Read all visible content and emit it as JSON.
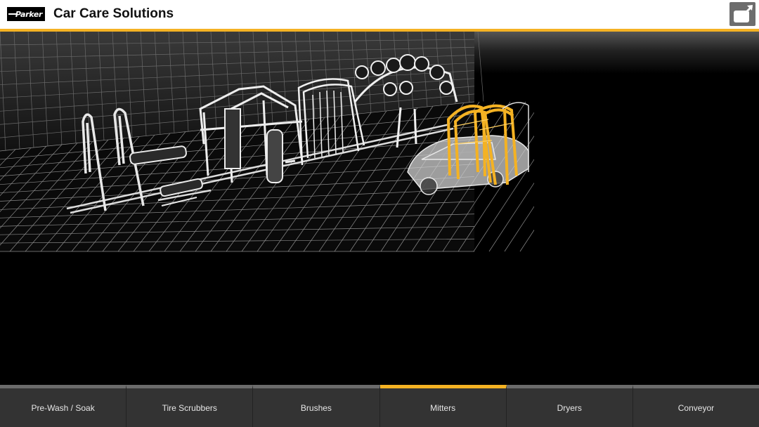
{
  "header": {
    "logo_text": "Parker",
    "title": "Car Care Solutions"
  },
  "icons": {
    "expand": "expand-icon"
  },
  "colors": {
    "accent": "#f4b223",
    "header_bg": "#ffffff",
    "tab_bg": "#333333",
    "tab_border": "#6b6b6b",
    "wireframe": "#e0e0e0",
    "highlight": "#f4b223"
  },
  "tabs": [
    {
      "label": "Pre-Wash / Soak",
      "active": false
    },
    {
      "label": "Tire Scrubbers",
      "active": false
    },
    {
      "label": "Brushes",
      "active": false
    },
    {
      "label": "Mitters",
      "active": true
    },
    {
      "label": "Dryers",
      "active": false
    },
    {
      "label": "Conveyor",
      "active": false
    }
  ]
}
